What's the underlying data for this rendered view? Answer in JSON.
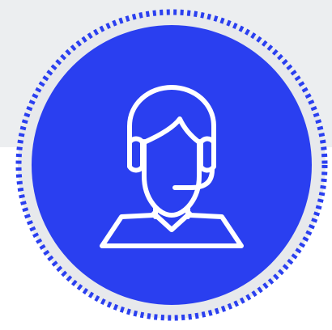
{
  "colors": {
    "backdrop": "#eceef0",
    "ring_fill": "#e7e9ec",
    "dots": "#2a3ff0",
    "circle": "#2a3ff0",
    "icon_stroke": "#ffffff"
  },
  "icon": {
    "name": "customer-support-agent-icon"
  }
}
